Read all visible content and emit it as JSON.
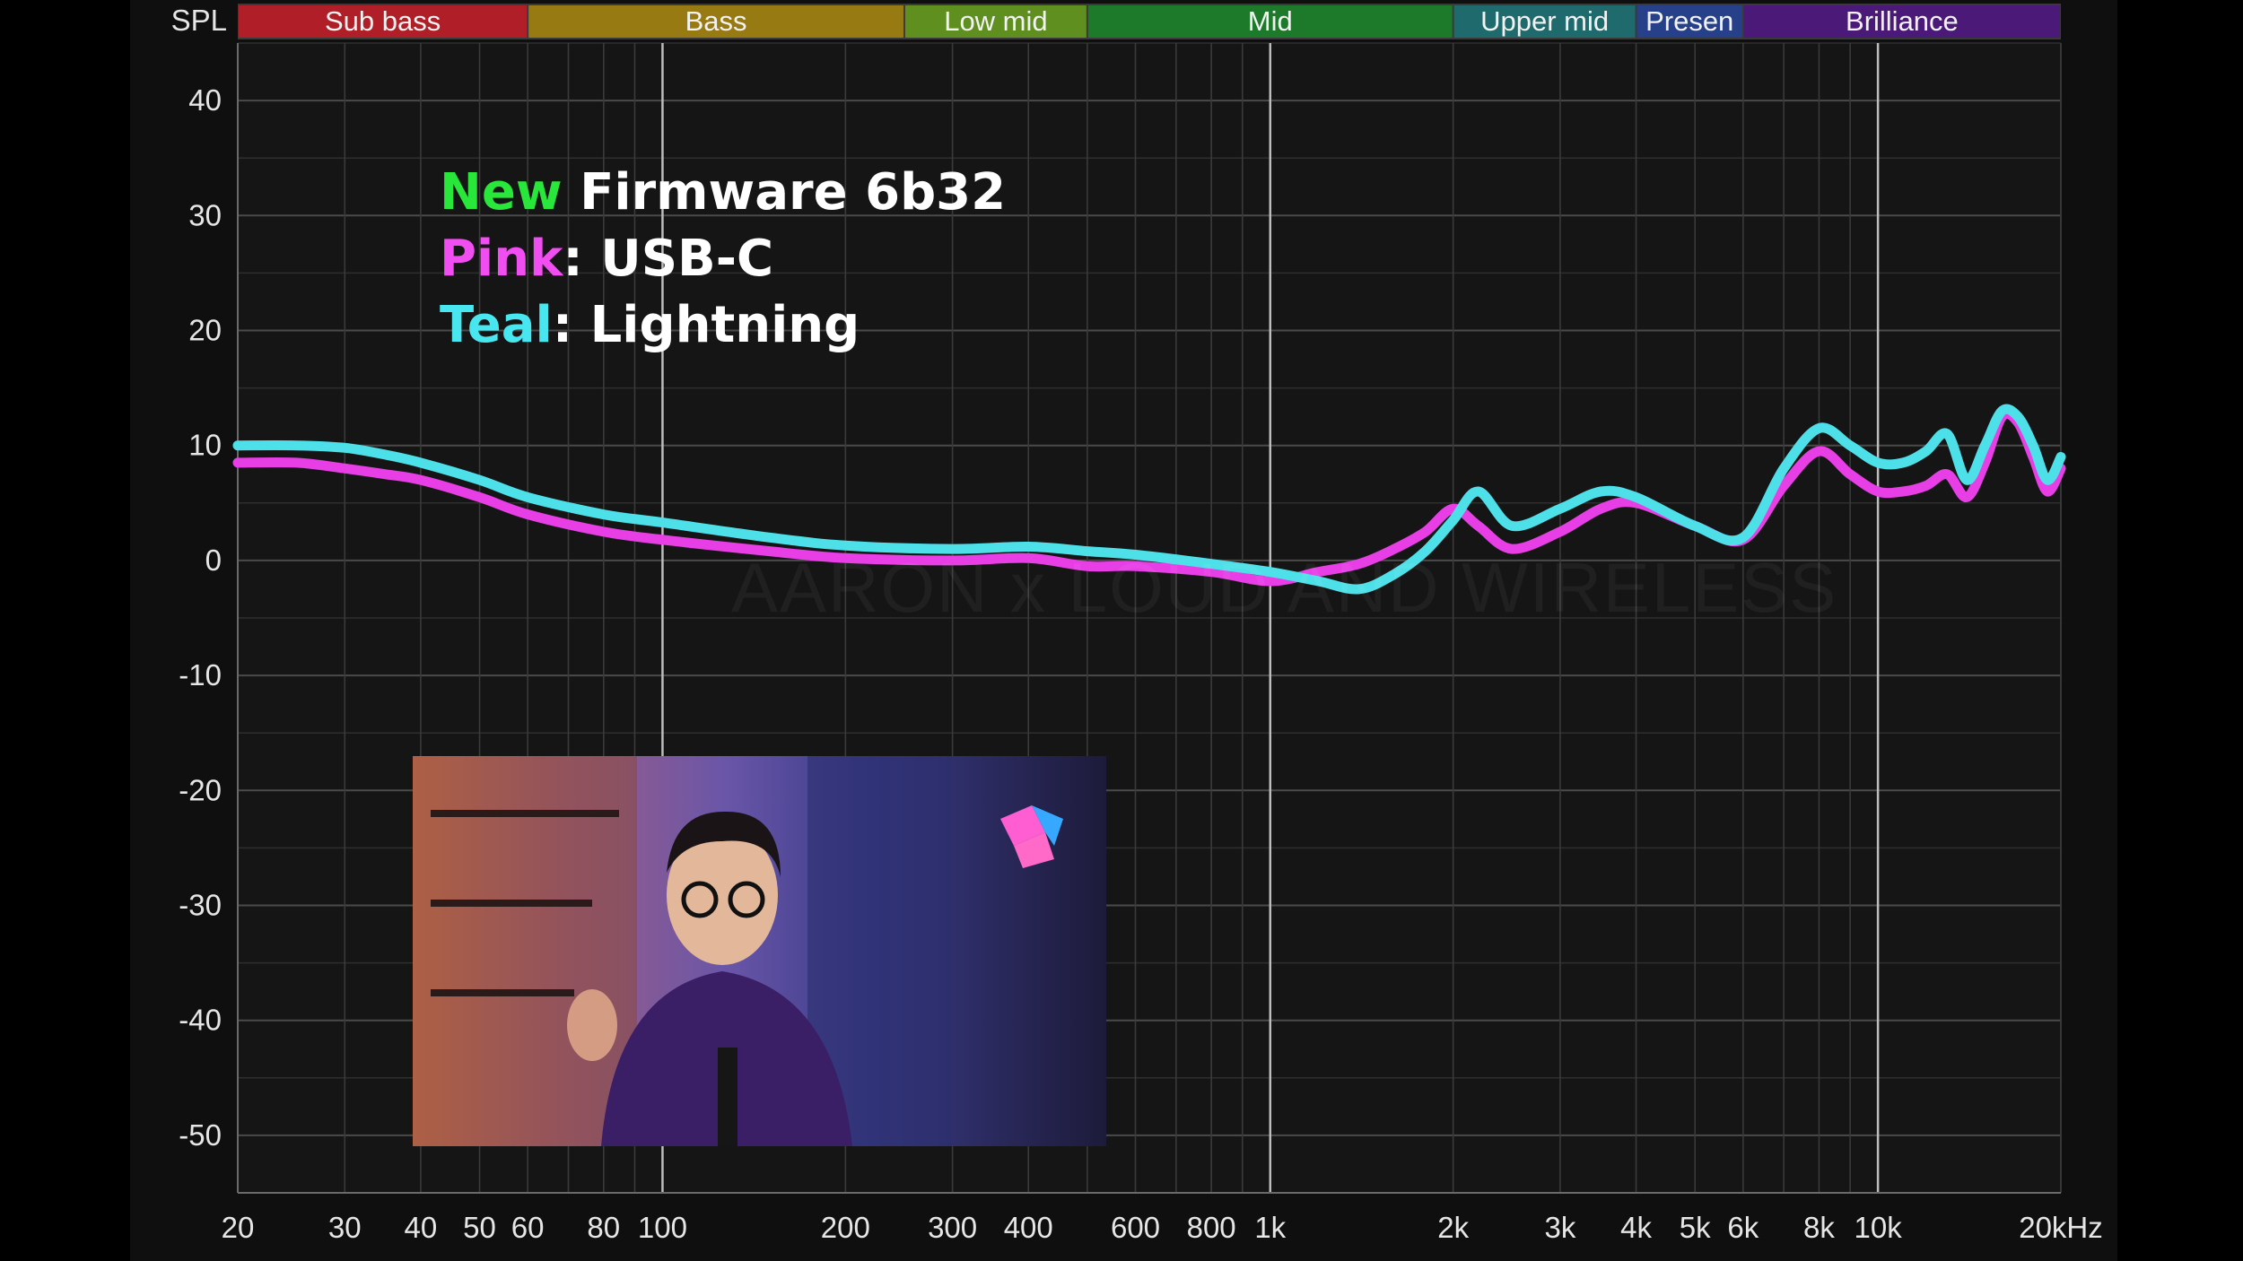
{
  "chart_data": {
    "type": "line",
    "ylabel": "SPL",
    "ylim": [
      -55,
      45
    ],
    "xlim": [
      20,
      20000
    ],
    "xscale": "log",
    "grid": true,
    "y_ticks": [
      40,
      30,
      20,
      10,
      0,
      -10,
      -20,
      -30,
      -40,
      -50
    ],
    "y_tick_labels": [
      "40",
      "30",
      "20",
      "10",
      "0",
      "-10",
      "-20",
      "-30",
      "-40",
      "-50"
    ],
    "x_ticks": [
      20,
      30,
      40,
      50,
      60,
      80,
      100,
      200,
      300,
      400,
      600,
      800,
      1000,
      2000,
      3000,
      4000,
      5000,
      6000,
      8000,
      10000,
      20000
    ],
    "x_tick_labels": [
      "20",
      "30",
      "40",
      "50",
      "60",
      "80",
      "100",
      "200",
      "300",
      "400",
      "600",
      "800",
      "1k",
      "2k",
      "3k",
      "4k",
      "5k",
      "6k",
      "8k",
      "10k",
      "20kHz"
    ],
    "bands": [
      {
        "label": "Sub bass",
        "from": 20,
        "to": 60,
        "color": "#b01f28"
      },
      {
        "label": "Bass",
        "from": 60,
        "to": 250,
        "color": "#977a12"
      },
      {
        "label": "Low mid",
        "from": 250,
        "to": 500,
        "color": "#5f8f1f"
      },
      {
        "label": "Mid",
        "from": 500,
        "to": 2000,
        "color": "#1c7a2a"
      },
      {
        "label": "Upper mid",
        "from": 2000,
        "to": 4000,
        "color": "#1f6a6c"
      },
      {
        "label": "Presen",
        "from": 4000,
        "to": 6000,
        "color": "#26408a"
      },
      {
        "label": "Brilliance",
        "from": 6000,
        "to": 20000,
        "color": "#4b1a78"
      }
    ],
    "series": [
      {
        "name": "USB-C",
        "color": "#e83ee6",
        "x": [
          20,
          25,
          30,
          35,
          40,
          50,
          60,
          80,
          100,
          150,
          200,
          300,
          400,
          500,
          600,
          800,
          1000,
          1200,
          1400,
          1600,
          1800,
          2000,
          2200,
          2500,
          3000,
          3500,
          4000,
          5000,
          6000,
          7000,
          8000,
          9000,
          10000,
          11000,
          12000,
          13000,
          14000,
          15000,
          16000,
          17000,
          18000,
          19000,
          20000
        ],
        "y": [
          8.5,
          8.5,
          8,
          7.5,
          7,
          5.5,
          4,
          2.5,
          1.8,
          0.8,
          0.2,
          0,
          0.2,
          -0.5,
          -0.5,
          -1,
          -1.8,
          -1,
          -0.3,
          1,
          2.5,
          4.5,
          3,
          1,
          2.5,
          4.5,
          5,
          3,
          1.8,
          6.5,
          9.5,
          7.5,
          6,
          6,
          6.5,
          7.5,
          5.5,
          8.5,
          12.5,
          12,
          9,
          6,
          8
        ]
      },
      {
        "name": "Lightning",
        "color": "#4ee0e8",
        "x": [
          20,
          25,
          30,
          35,
          40,
          50,
          60,
          80,
          100,
          150,
          200,
          300,
          400,
          500,
          600,
          800,
          1000,
          1200,
          1400,
          1600,
          1800,
          2000,
          2200,
          2500,
          3000,
          3500,
          4000,
          5000,
          6000,
          7000,
          8000,
          9000,
          10000,
          11000,
          12000,
          13000,
          14000,
          15000,
          16000,
          17000,
          18000,
          19000,
          20000
        ],
        "y": [
          10,
          10,
          9.8,
          9.2,
          8.5,
          7,
          5.5,
          4,
          3.3,
          2,
          1.3,
          1,
          1.2,
          0.8,
          0.5,
          -0.3,
          -1,
          -1.8,
          -2.5,
          -1.2,
          0.8,
          3.5,
          6,
          3,
          4.5,
          6,
          5.5,
          3,
          2,
          8,
          11.5,
          10,
          8.5,
          8.5,
          9.5,
          11,
          7,
          10,
          13,
          12.5,
          10,
          7,
          9
        ]
      }
    ],
    "legend_lines": [
      {
        "highlight": "New",
        "highlight_color": "#29e63a",
        "rest": " Firmware 6b32"
      },
      {
        "highlight": "Pink",
        "highlight_color": "#f04ef0",
        "rest": ": USB-C"
      },
      {
        "highlight": "Teal",
        "highlight_color": "#48e6ee",
        "rest": ": Lightning"
      }
    ],
    "watermark": "AARON x LOUD AND WIRELESS"
  }
}
